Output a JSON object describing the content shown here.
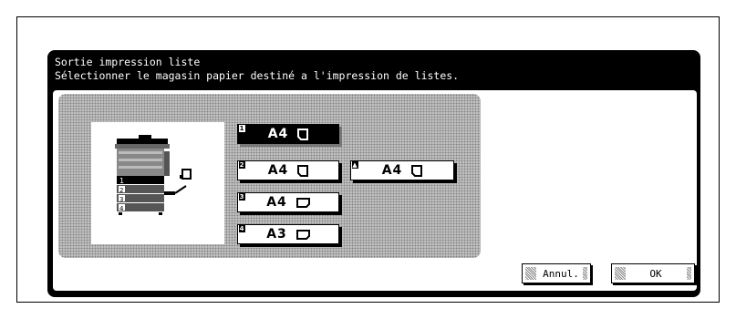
{
  "dialog": {
    "title": "Sortie impression liste",
    "subtitle": "Sélectionner le magasin papier destiné a l'impression de listes."
  },
  "trays": [
    {
      "number": "1",
      "label": "A4",
      "orientation": "portrait",
      "selected": true
    },
    {
      "number": "2",
      "label": "A4",
      "orientation": "portrait",
      "selected": false
    },
    {
      "number": "3",
      "label": "A4",
      "orientation": "landscape",
      "selected": false
    },
    {
      "number": "4",
      "label": "A3",
      "orientation": "landscape",
      "selected": false
    },
    {
      "number": "bypass",
      "label": "A4",
      "orientation": "portrait",
      "selected": false
    }
  ],
  "copier_diagram": {
    "tray_numbers": [
      "1",
      "2",
      "3",
      "4"
    ]
  },
  "footer": {
    "cancel_label": "Annul.",
    "ok_label": "OK"
  }
}
